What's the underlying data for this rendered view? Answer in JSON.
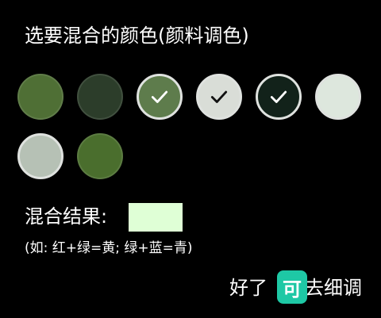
{
  "dialog": {
    "title": "选要混合的颜色(颜料调色)",
    "result_label": "混合结果:",
    "result_color": "#dfffd6",
    "hint": "(如: 红+绿=黄; 绿+蓝=青)",
    "ok_label": "好了",
    "fine_tune_label": "去细调",
    "overlay_badge_text": "可"
  },
  "swatches": [
    {
      "color": "#4f6f35",
      "selected": false,
      "icon": "none"
    },
    {
      "color": "#2c3d2a",
      "selected": false,
      "icon": "none"
    },
    {
      "color": "#5e7c4c",
      "selected": true,
      "icon": "check-icon"
    },
    {
      "color": "#d9ddd7",
      "selected": true,
      "icon": "check-icon"
    },
    {
      "color": "#12221a",
      "selected": true,
      "icon": "check-icon"
    },
    {
      "color": "#dde7dd",
      "selected": false,
      "icon": "none"
    },
    {
      "color": "#b6c1b5",
      "selected": false,
      "icon": "none"
    },
    {
      "color": "#4a6e2d",
      "selected": false,
      "icon": "none"
    }
  ]
}
